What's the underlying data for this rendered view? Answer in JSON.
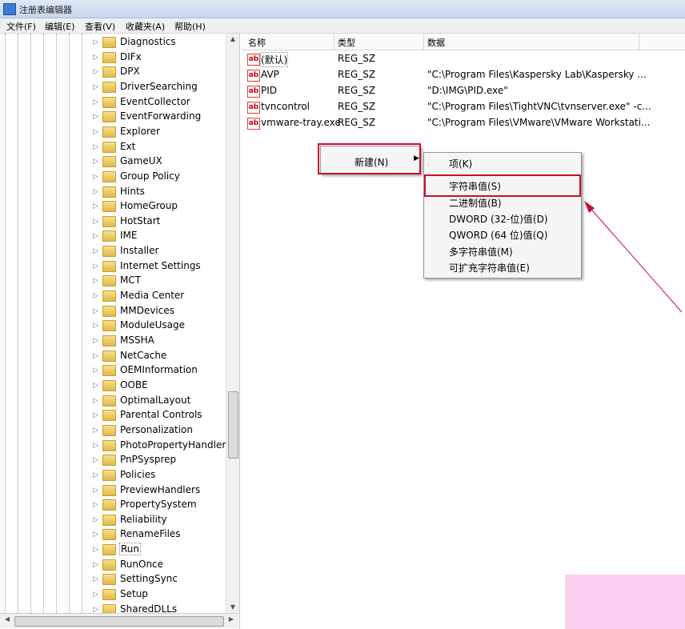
{
  "window": {
    "title": "注册表编辑器"
  },
  "menubar": [
    "文件(F)",
    "编辑(E)",
    "查看(V)",
    "收藏夹(A)",
    "帮助(H)"
  ],
  "tree": {
    "items": [
      "Diagnostics",
      "DIFx",
      "DPX",
      "DriverSearching",
      "EventCollector",
      "EventForwarding",
      "Explorer",
      "Ext",
      "GameUX",
      "Group Policy",
      "Hints",
      "HomeGroup",
      "HotStart",
      "IME",
      "Installer",
      "Internet Settings",
      "MCT",
      "Media Center",
      "MMDevices",
      "ModuleUsage",
      "MSSHA",
      "NetCache",
      "OEMInformation",
      "OOBE",
      "OptimalLayout",
      "Parental Controls",
      "Personalization",
      "PhotoPropertyHandler",
      "PnPSysprep",
      "Policies",
      "PreviewHandlers",
      "PropertySystem",
      "Reliability",
      "RenameFiles",
      "Run",
      "RunOnce",
      "SettingSync",
      "Setup",
      "SharedDLLs"
    ],
    "selected": "Run"
  },
  "list": {
    "columns": [
      "名称",
      "类型",
      "数据"
    ],
    "rows": [
      {
        "name": "(默认)",
        "type": "REG_SZ",
        "data": ""
      },
      {
        "name": "AVP",
        "type": "REG_SZ",
        "data": "\"C:\\Program Files\\Kaspersky Lab\\Kaspersky ..."
      },
      {
        "name": "PID",
        "type": "REG_SZ",
        "data": "\"D:\\IMG\\PID.exe\""
      },
      {
        "name": "tvncontrol",
        "type": "REG_SZ",
        "data": "\"C:\\Program Files\\TightVNC\\tvnserver.exe\" -c..."
      },
      {
        "name": "vmware-tray.exe",
        "type": "REG_SZ",
        "data": "\"C:\\Program Files\\VMware\\VMware Workstati..."
      }
    ]
  },
  "context_menu": {
    "new_label": "新建(N)"
  },
  "submenu": {
    "items": [
      "项(K)",
      "字符串值(S)",
      "二进制值(B)",
      "DWORD (32-位)值(D)",
      "QWORD (64 位)值(Q)",
      "多字符串值(M)",
      "可扩充字符串值(E)"
    ],
    "highlighted": "字符串值(S)"
  },
  "annotation_color": "#c8102e"
}
